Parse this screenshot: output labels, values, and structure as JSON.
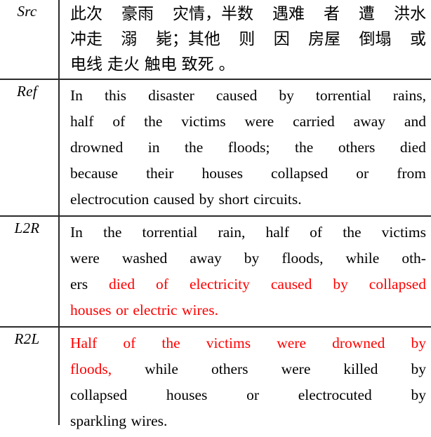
{
  "table": {
    "divider_color": "#2b2b2b",
    "highlight_color": "#ff0000",
    "text_color": "#000000",
    "rows": [
      {
        "label": "Src",
        "lines": [
          {
            "segments": [
              {
                "text": "此次",
                "color": "black"
              },
              {
                "text": "豪雨",
                "color": "black"
              },
              {
                "text": "灾情，半数",
                "color": "black"
              },
              {
                "text": "遇难",
                "color": "black"
              },
              {
                "text": "者",
                "color": "black"
              },
              {
                "text": "遭",
                "color": "black"
              },
              {
                "text": "洪水",
                "color": "black"
              }
            ]
          },
          {
            "segments": [
              {
                "text": "冲走",
                "color": "black"
              },
              {
                "text": "溺",
                "color": "black"
              },
              {
                "text": "毙；其他",
                "color": "black"
              },
              {
                "text": "则",
                "color": "black"
              },
              {
                "text": "因",
                "color": "black"
              },
              {
                "text": "房屋",
                "color": "black"
              },
              {
                "text": "倒塌",
                "color": "black"
              },
              {
                "text": "或",
                "color": "black"
              }
            ]
          },
          {
            "segments": [
              {
                "text": "电线",
                "color": "black"
              },
              {
                "text": "走火",
                "color": "black"
              },
              {
                "text": "触电",
                "color": "black"
              },
              {
                "text": "致死",
                "color": "black"
              },
              {
                "text": "。",
                "color": "black"
              }
            ],
            "align": "left"
          }
        ]
      },
      {
        "label": "Ref",
        "lines": [
          {
            "segments": [
              {
                "text": "In",
                "color": "black"
              },
              {
                "text": "this",
                "color": "black"
              },
              {
                "text": "disaster",
                "color": "black"
              },
              {
                "text": "caused",
                "color": "black"
              },
              {
                "text": "by",
                "color": "black"
              },
              {
                "text": "torrential",
                "color": "black"
              },
              {
                "text": "rains,",
                "color": "black"
              }
            ]
          },
          {
            "segments": [
              {
                "text": "half",
                "color": "black"
              },
              {
                "text": "of",
                "color": "black"
              },
              {
                "text": "the",
                "color": "black"
              },
              {
                "text": "victims",
                "color": "black"
              },
              {
                "text": "were",
                "color": "black"
              },
              {
                "text": "carried",
                "color": "black"
              },
              {
                "text": "away",
                "color": "black"
              },
              {
                "text": "and",
                "color": "black"
              }
            ]
          },
          {
            "segments": [
              {
                "text": "drowned",
                "color": "black"
              },
              {
                "text": "in",
                "color": "black"
              },
              {
                "text": "the",
                "color": "black"
              },
              {
                "text": "floods;",
                "color": "black"
              },
              {
                "text": "the",
                "color": "black"
              },
              {
                "text": "others",
                "color": "black"
              },
              {
                "text": "died",
                "color": "black"
              }
            ]
          },
          {
            "segments": [
              {
                "text": "because",
                "color": "black"
              },
              {
                "text": "their",
                "color": "black"
              },
              {
                "text": "houses",
                "color": "black"
              },
              {
                "text": "collapsed",
                "color": "black"
              },
              {
                "text": "or",
                "color": "black"
              },
              {
                "text": "from",
                "color": "black"
              }
            ]
          },
          {
            "segments": [
              {
                "text": "electrocution",
                "color": "black"
              },
              {
                "text": "caused",
                "color": "black"
              },
              {
                "text": "by",
                "color": "black"
              },
              {
                "text": "short",
                "color": "black"
              },
              {
                "text": "circuits.",
                "color": "black"
              }
            ],
            "align": "left"
          }
        ]
      },
      {
        "label": "L2R",
        "lines": [
          {
            "segments": [
              {
                "text": "In",
                "color": "black"
              },
              {
                "text": "the",
                "color": "black"
              },
              {
                "text": "torrential",
                "color": "black"
              },
              {
                "text": "rain,",
                "color": "black"
              },
              {
                "text": "half",
                "color": "black"
              },
              {
                "text": "of",
                "color": "black"
              },
              {
                "text": "the",
                "color": "black"
              },
              {
                "text": "victims",
                "color": "black"
              }
            ]
          },
          {
            "segments": [
              {
                "text": "were",
                "color": "black"
              },
              {
                "text": "washed",
                "color": "black"
              },
              {
                "text": "away",
                "color": "black"
              },
              {
                "text": "by",
                "color": "black"
              },
              {
                "text": "floods,",
                "color": "black"
              },
              {
                "text": "while",
                "color": "black"
              },
              {
                "text": "oth-",
                "color": "black"
              }
            ]
          },
          {
            "segments": [
              {
                "text": "ers",
                "color": "black"
              },
              {
                "text": "died",
                "color": "red"
              },
              {
                "text": "of",
                "color": "red"
              },
              {
                "text": "electricity",
                "color": "red"
              },
              {
                "text": "caused",
                "color": "red"
              },
              {
                "text": "by",
                "color": "red"
              },
              {
                "text": "collapsed",
                "color": "red"
              }
            ]
          },
          {
            "segments": [
              {
                "text": "houses",
                "color": "red"
              },
              {
                "text": "or",
                "color": "red"
              },
              {
                "text": "electric",
                "color": "red"
              },
              {
                "text": "wires.",
                "color": "red"
              }
            ],
            "align": "left"
          }
        ]
      },
      {
        "label": "R2L",
        "lines": [
          {
            "segments": [
              {
                "text": "Half",
                "color": "red"
              },
              {
                "text": "of",
                "color": "red"
              },
              {
                "text": "the",
                "color": "red"
              },
              {
                "text": "victims",
                "color": "red"
              },
              {
                "text": "were",
                "color": "red"
              },
              {
                "text": "drowned",
                "color": "red"
              },
              {
                "text": "by",
                "color": "red"
              }
            ]
          },
          {
            "segments": [
              {
                "text": "floods,",
                "color": "red"
              },
              {
                "text": "while",
                "color": "black"
              },
              {
                "text": "others",
                "color": "black"
              },
              {
                "text": "were",
                "color": "black"
              },
              {
                "text": "killed",
                "color": "black"
              },
              {
                "text": "by",
                "color": "black"
              }
            ]
          },
          {
            "segments": [
              {
                "text": "collapsed",
                "color": "black"
              },
              {
                "text": "houses",
                "color": "black"
              },
              {
                "text": "or",
                "color": "black"
              },
              {
                "text": "electrocuted",
                "color": "black"
              },
              {
                "text": "by",
                "color": "black"
              }
            ]
          },
          {
            "segments": [
              {
                "text": "sparkling",
                "color": "black"
              },
              {
                "text": "wires.",
                "color": "black"
              }
            ],
            "align": "left"
          }
        ]
      }
    ]
  }
}
